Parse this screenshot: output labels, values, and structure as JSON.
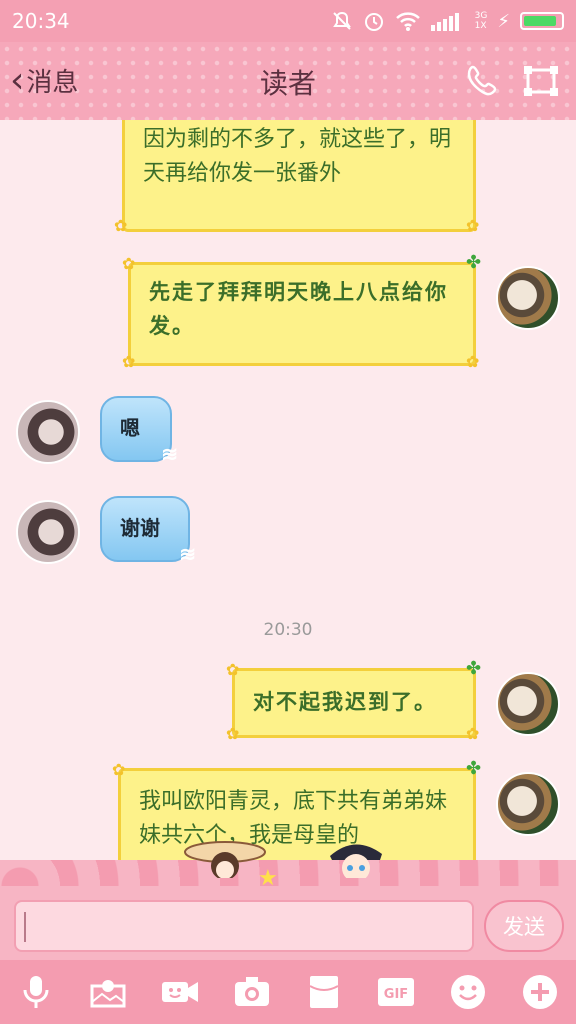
{
  "status_bar": {
    "time": "20:34",
    "network_top": "3G",
    "network_bottom": "1X"
  },
  "nav": {
    "back_label": "消息",
    "title": "读者"
  },
  "messages": [
    {
      "from": "me",
      "text": "因为剩的不多了，就这些了，明天再给你发一张番外"
    },
    {
      "from": "me",
      "text": "先走了拜拜明天晚上八点给你发。"
    },
    {
      "from": "other",
      "text": "嗯"
    },
    {
      "from": "other",
      "text": "谢谢"
    },
    {
      "from": "me",
      "text": "对不起我迟到了。"
    },
    {
      "from": "me",
      "text": "我叫欧阳青灵，底下共有弟弟妹妹共六个，我是母皇的"
    }
  ],
  "timestamp": "20:30",
  "input": {
    "value": "",
    "send_label": "发送"
  },
  "toolbar": {
    "gif_label": "GIF"
  },
  "colors": {
    "accent_pink": "#f49cb0",
    "yellow_bubble": "#fdf28a",
    "blue_bubble": "#84c7f1",
    "text_green": "#3b6e2a"
  }
}
